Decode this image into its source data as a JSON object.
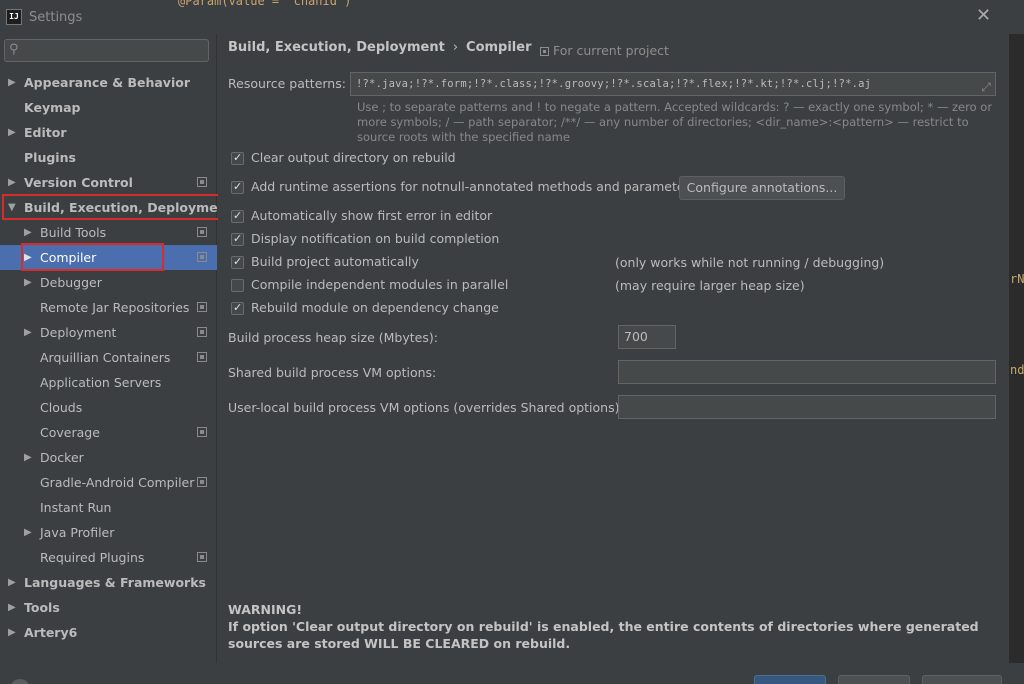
{
  "window": {
    "title": "Settings",
    "app_icon_text": "IJ",
    "background_code_fragment": "@Param(value = \"chanId\")"
  },
  "sidebar": {
    "search_placeholder": "Q",
    "items": [
      {
        "label": "Appearance & Behavior",
        "arrow": "▶",
        "bold": true
      },
      {
        "label": "Keymap",
        "bold": true
      },
      {
        "label": "Editor",
        "arrow": "▶",
        "bold": true
      },
      {
        "label": "Plugins",
        "bold": true
      },
      {
        "label": "Version Control",
        "arrow": "▶",
        "bold": true,
        "project_icon": true
      },
      {
        "label": "Build, Execution, Deployment",
        "arrow": "▼",
        "bold": true
      },
      {
        "label": "Build Tools",
        "arrow": "▶",
        "project_icon": true
      },
      {
        "label": "Compiler",
        "arrow": "▶",
        "selected": true,
        "project_icon": true
      },
      {
        "label": "Debugger",
        "arrow": "▶"
      },
      {
        "label": "Remote Jar Repositories",
        "project_icon": true
      },
      {
        "label": "Deployment",
        "arrow": "▶",
        "project_icon": true
      },
      {
        "label": "Arquillian Containers",
        "project_icon": true
      },
      {
        "label": "Application Servers"
      },
      {
        "label": "Clouds"
      },
      {
        "label": "Coverage",
        "project_icon": true
      },
      {
        "label": "Docker",
        "arrow": "▶"
      },
      {
        "label": "Gradle-Android Compiler",
        "project_icon": true
      },
      {
        "label": "Instant Run"
      },
      {
        "label": "Java Profiler",
        "arrow": "▶"
      },
      {
        "label": "Required Plugins",
        "project_icon": true
      },
      {
        "label": "Languages & Frameworks",
        "arrow": "▶",
        "bold": true
      },
      {
        "label": "Tools",
        "arrow": "▶",
        "bold": true
      },
      {
        "label": "Artery6",
        "arrow": "▶",
        "bold": true
      }
    ]
  },
  "main": {
    "breadcrumb": {
      "parent": "Build, Execution, Deployment",
      "separator": "›",
      "current": "Compiler"
    },
    "scope_label": "For current project",
    "resource_patterns": {
      "label": "Resource patterns:",
      "value": "!?*.java;!?*.form;!?*.class;!?*.groovy;!?*.scala;!?*.flex;!?*.kt;!?*.clj;!?*.aj",
      "help": "Use ; to separate patterns and ! to negate a pattern. Accepted wildcards: ? — exactly one symbol; * — zero or more symbols; / — path separator; /**/ — any number of directories; <dir_name>:<pattern> — restrict to source roots with the specified name"
    },
    "options": [
      {
        "label": "Clear output directory on rebuild",
        "checked": true
      },
      {
        "label": "Add runtime assertions for notnull-annotated methods and parameters",
        "checked": true
      },
      {
        "label": "Automatically show first error in editor",
        "checked": true
      },
      {
        "label": "Display notification on build completion",
        "checked": true
      },
      {
        "label": "Build project automatically",
        "checked": true
      },
      {
        "label": "Compile independent modules in parallel",
        "checked": false
      },
      {
        "label": "Rebuild module on dependency change",
        "checked": true
      }
    ],
    "configure_annotations_label": "Configure annotations...",
    "note_build_auto": "(only works while not running / debugging)",
    "note_parallel": "(may require larger heap size)",
    "heap_size": {
      "label": "Build process heap size (Mbytes):",
      "value": "700"
    },
    "shared_vm": {
      "label": "Shared build process VM options:",
      "value": ""
    },
    "user_vm": {
      "label": "User-local build process VM options (overrides Shared options):",
      "value": ""
    },
    "warning": {
      "title": "WARNING!",
      "text": "If option 'Clear output directory on rebuild' is enabled, the entire contents of directories where generated sources are stored WILL BE CLEARED on rebuild."
    }
  },
  "background_right_fragments": [
    "rN",
    "nd"
  ],
  "colors": {
    "accent_selection": "#4b6eaf",
    "highlight_box": "#d72c2c",
    "background": "#3c3f41"
  }
}
